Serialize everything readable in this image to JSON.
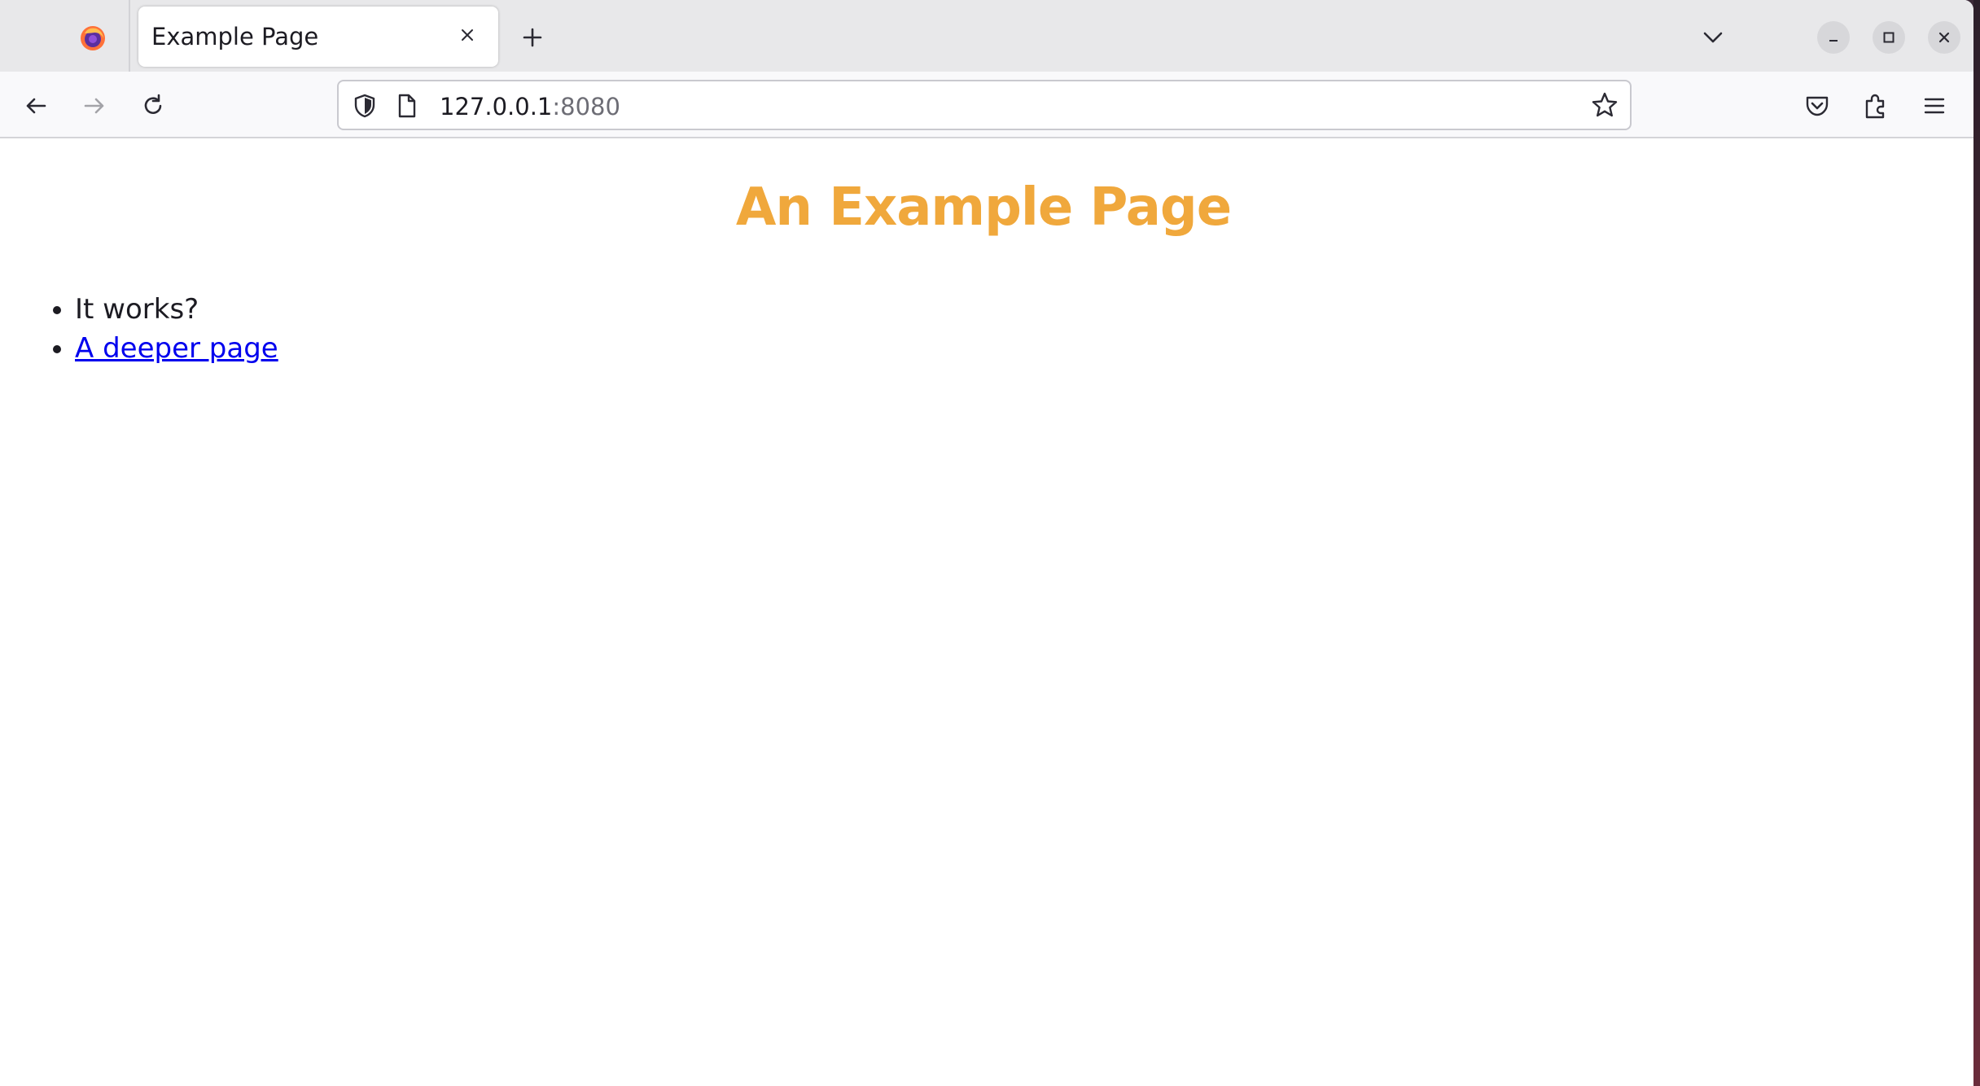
{
  "browser": {
    "tab": {
      "title": "Example Page"
    },
    "url": {
      "host": "127.0.0.1",
      "port": ":8080"
    },
    "colors": {
      "accent_heading": "#f0a83c",
      "link": "#0000ee"
    },
    "icons": {
      "logo": "firefox-logo-icon",
      "close_tab": "close-icon",
      "new_tab": "plus-icon",
      "tab_list": "chevron-down-icon",
      "minimize": "minimize-icon",
      "maximize": "maximize-icon",
      "close_window": "close-icon",
      "back": "arrow-left-icon",
      "forward": "arrow-right-icon",
      "reload": "reload-icon",
      "tracking": "shield-icon",
      "page": "page-icon",
      "bookmark": "star-icon",
      "pocket": "pocket-icon",
      "extensions": "puzzle-icon",
      "menu": "hamburger-icon"
    }
  },
  "page": {
    "heading": "An Example Page",
    "items": [
      {
        "text": "It works?"
      },
      {
        "link_text": "A deeper page"
      }
    ]
  }
}
